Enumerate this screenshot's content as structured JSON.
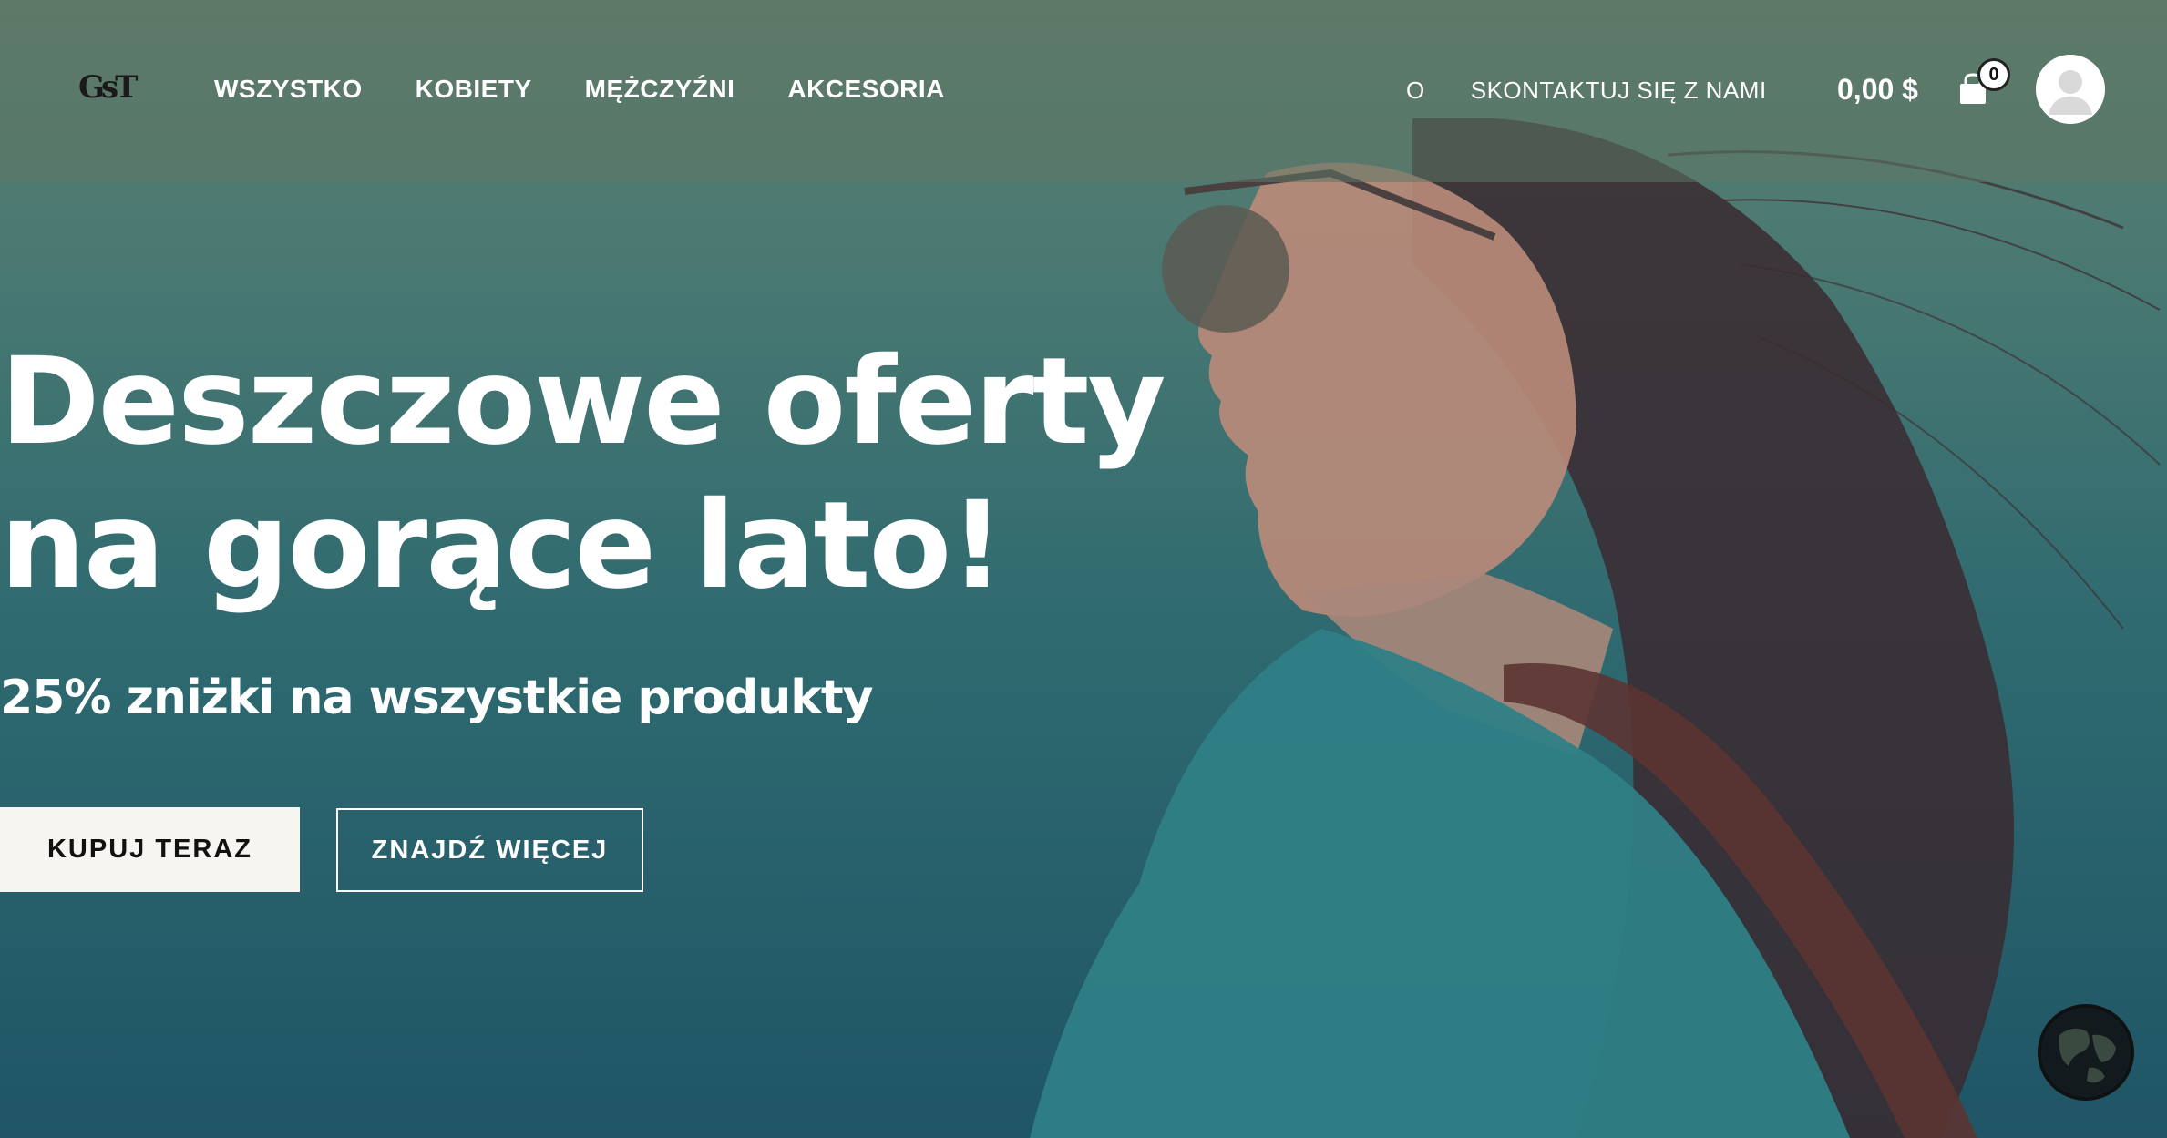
{
  "header": {
    "logo_text": "GsT",
    "nav_left": [
      "WSZYSTKO",
      "KOBIETY",
      "MĘŻCZYŹNI",
      "AKCESORIA"
    ],
    "nav_right": [
      "O",
      "SKONTAKTUJ SIĘ Z NAMI"
    ],
    "cart_total": "0,00 $",
    "cart_count": "0",
    "icons": [
      "shopping-bag-icon",
      "user-avatar-icon"
    ]
  },
  "hero": {
    "headline_line1": "Deszczowe oferty",
    "headline_line2": "na gorące lato!",
    "subheadline": "25% zniżki na wszystkie produkty",
    "primary_cta": "KUPUJ TERAZ",
    "secondary_cta": "ZNAJDŹ WIĘCEJ"
  },
  "widgets": {
    "language_icon": "globe-icon"
  },
  "colors": {
    "header_overlay": "#5c7666",
    "hero_top": "#5e7d6c",
    "hero_bottom": "#1f5566",
    "button_light": "#f7f5f1",
    "text": "#ffffff"
  }
}
